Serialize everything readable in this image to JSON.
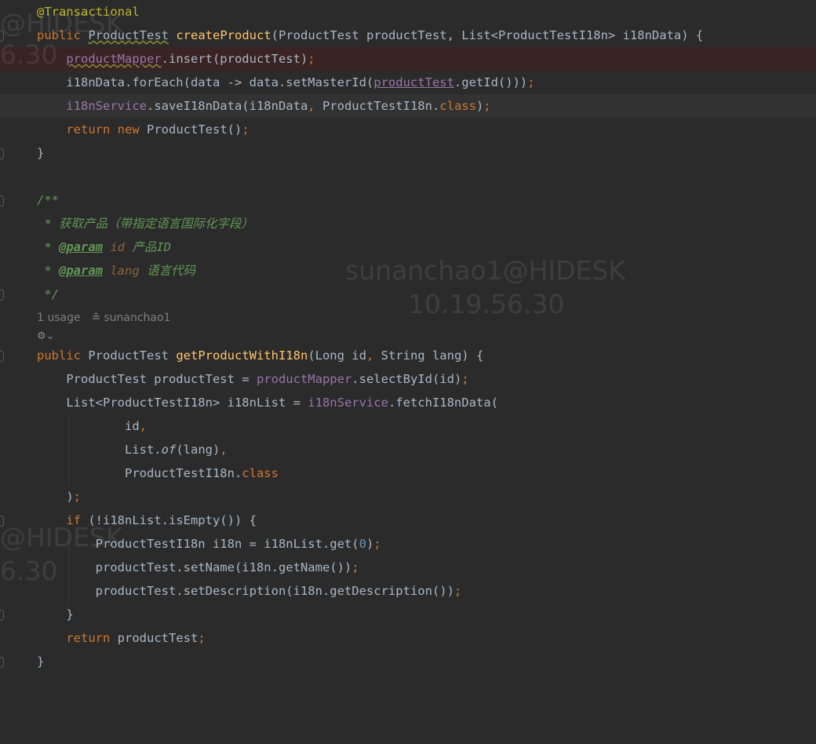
{
  "code": {
    "annotation": "@Transactional",
    "l2": {
      "mod": "public",
      "type": "ProductTest",
      "method": "createProduct",
      "params": "(ProductTest productTest, List<ProductTestI18n> i18nData) {"
    },
    "l3": {
      "field": "productMapper",
      "rest": ".insert(productTest)",
      "semi": ";"
    },
    "l4": {
      "a": "i18nData.forEach(data -> data.setMasterId(",
      "ref": "productTest",
      "b": ".getId()))",
      "semi": ";"
    },
    "l5": {
      "field": "i18nService",
      "a": ".saveI18nData(i18nData",
      "comma": ",",
      "b": " ProductTestI18n.",
      "kw": "class",
      "c": ")",
      "semi": ";"
    },
    "l6": {
      "kw_return": "return",
      "kw_new": "new",
      "rest": " ProductTest()",
      "semi": ";"
    },
    "l7": "}",
    "l9": "/**",
    "l10": " * 获取产品（带指定语言国际化字段）",
    "l11": {
      "star": " * ",
      "tag": "@param",
      "name": " id",
      "desc": " 产品ID"
    },
    "l12": {
      "star": " * ",
      "tag": "@param",
      "name": " lang",
      "desc": " 语言代码"
    },
    "l13": " */",
    "inlay": {
      "usages": "1 usage",
      "user_icon": "≗",
      "author": "sunanchao1"
    },
    "ai_icon": "⚙⌄",
    "l16": {
      "mod": "public",
      "type": " ProductTest ",
      "method": "getProductWithI18n",
      "a": "(Long id",
      "comma": ",",
      "b": " String lang) {"
    },
    "l17": {
      "a": "ProductTest productTest = ",
      "field": "productMapper",
      "b": ".selectById(id)",
      "semi": ";"
    },
    "l18": {
      "a": "List<ProductTestI18n> i18nList = ",
      "field": "i18nService",
      "b": ".fetchI18nData("
    },
    "l19": {
      "a": "id",
      "comma": ","
    },
    "l20": {
      "a": "List.",
      "of": "of",
      "b": "(lang)",
      "comma": ","
    },
    "l21": {
      "a": "ProductTestI18n.",
      "kw": "class"
    },
    "l22": {
      "a": ")",
      "semi": ";"
    },
    "l23": {
      "kw": "if",
      "rest": " (!i18nList.isEmpty()) {"
    },
    "l24": {
      "a": "ProductTestI18n i18n = i18nList.get(",
      "num": "0",
      "b": ")",
      "semi": ";"
    },
    "l25": {
      "a": "productTest.setName(i18n.getName())",
      "semi": ";"
    },
    "l26": {
      "a": "productTest.setDescription(i18n.getDescription())",
      "semi": ";"
    },
    "l27": "}",
    "l28": {
      "kw": "return",
      "rest": " productTest",
      "semi": ";"
    },
    "l29": "}"
  },
  "watermarks": {
    "user": "sunanchao1@HIDESK",
    "ip": "10.19.56.30",
    "edge_user_top": "@HIDESK",
    "edge_ip_top": "6.30",
    "edge_user_bottom": "@HIDESK",
    "edge_ip_bottom": "6.30"
  }
}
